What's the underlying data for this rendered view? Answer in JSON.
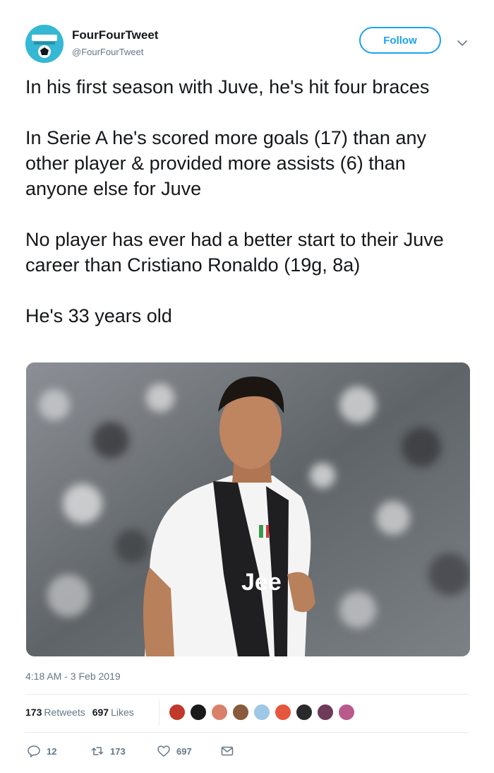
{
  "account": {
    "display_name": "FourFourTweet",
    "handle": "@FourFourTweet"
  },
  "follow_label": "Follow",
  "tweet": {
    "paragraphs": [
      "In his first season with Juve, he's hit four braces",
      "In Serie A he's scored more goals (17) than any other player & provided more assists (6) than anyone else for Juve",
      "No player has ever had a better start to their Juve career than Cristiano Ronaldo (19g, 8a)",
      "He's 33 years old"
    ],
    "timestamp": "4:18 AM - 3 Feb 2019"
  },
  "photo": {
    "jersey_text": "Jee"
  },
  "stats": {
    "retweets_count": "173",
    "retweets_label": "Retweets",
    "likes_count": "697",
    "likes_label": "Likes"
  },
  "actions": {
    "reply_count": "12",
    "retweet_count": "173",
    "like_count": "697"
  },
  "colors": {
    "accent": "#1da1f2",
    "muted": "#657786",
    "avatar": "#35b8d4"
  },
  "liker_colors": [
    "#c0392b",
    "#1a1a1a",
    "#d9806b",
    "#8a5a3c",
    "#9fc7e6",
    "#e4573d",
    "#2a2a2a",
    "#6d3a5a",
    "#b85a8c"
  ]
}
